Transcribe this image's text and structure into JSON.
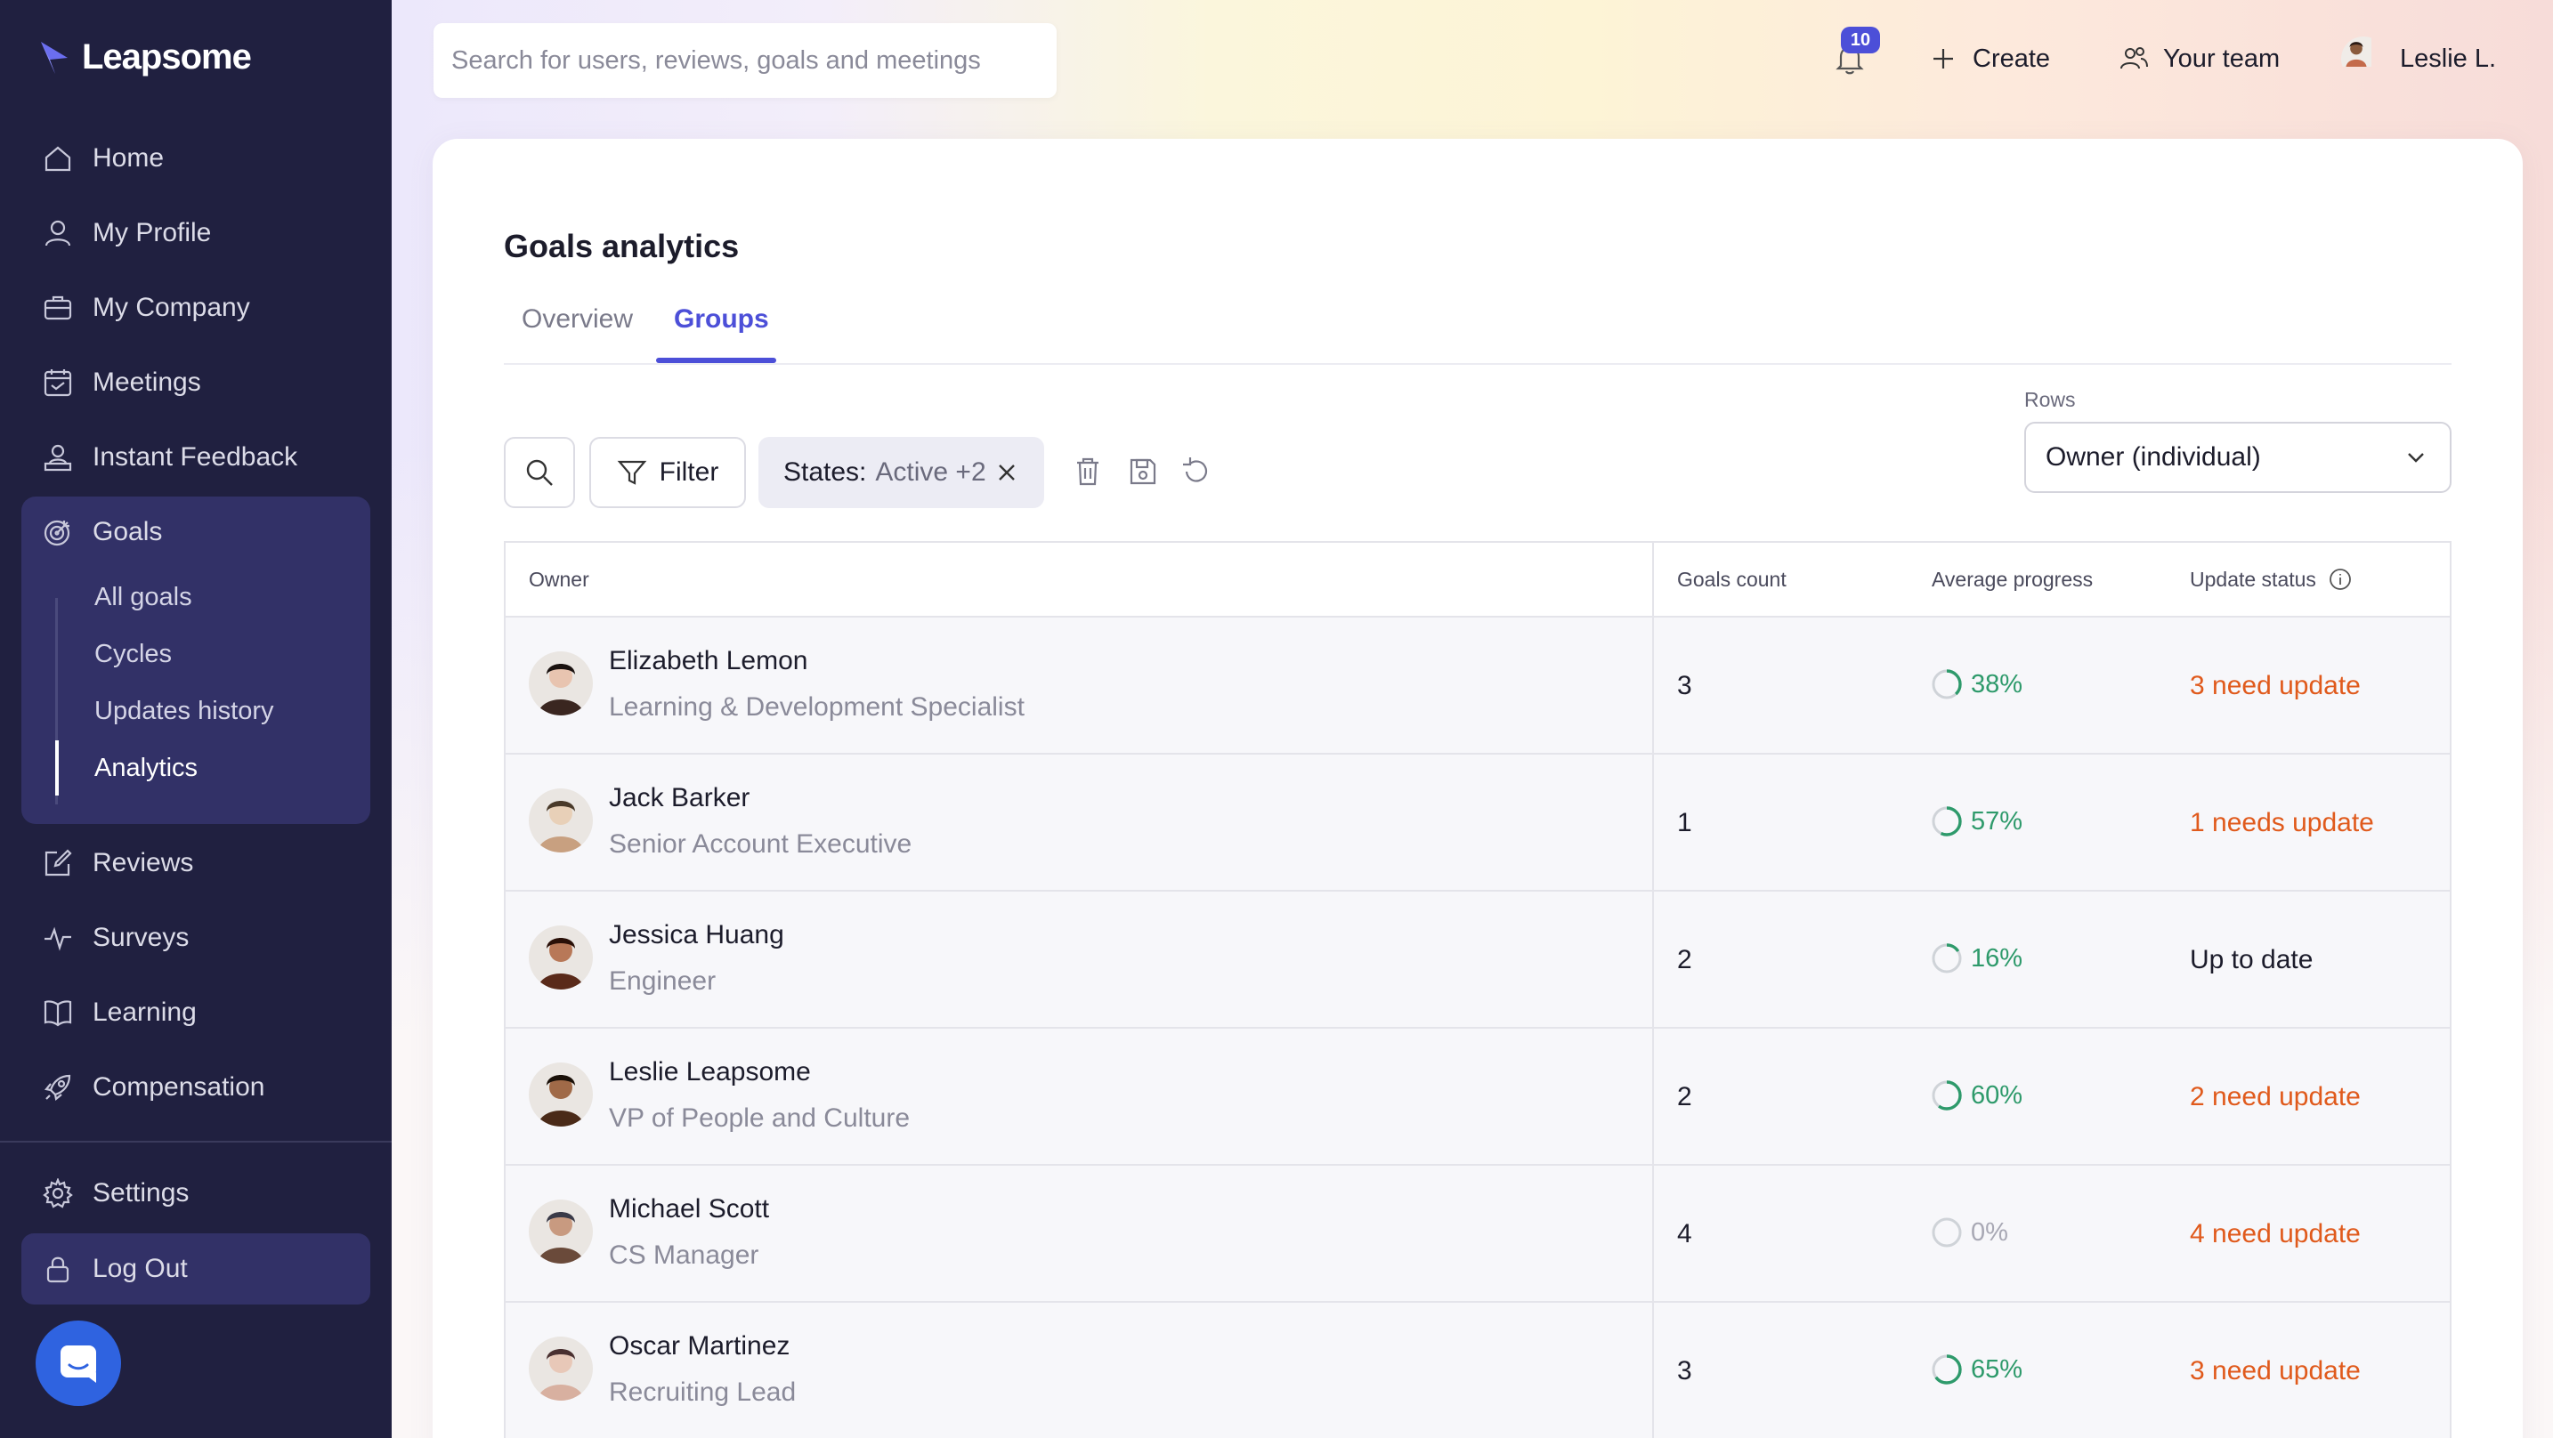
{
  "brand": {
    "name": "Leapsome"
  },
  "sidebar": {
    "items": [
      {
        "label": "Home",
        "icon": "home-icon"
      },
      {
        "label": "My Profile",
        "icon": "user-icon"
      },
      {
        "label": "My Company",
        "icon": "briefcase-icon"
      },
      {
        "label": "Meetings",
        "icon": "calendar-icon"
      },
      {
        "label": "Instant Feedback",
        "icon": "feedback-icon"
      },
      {
        "label": "Goals",
        "icon": "target-icon"
      },
      {
        "label": "Reviews",
        "icon": "edit-icon"
      },
      {
        "label": "Surveys",
        "icon": "pulse-icon"
      },
      {
        "label": "Learning",
        "icon": "book-icon"
      },
      {
        "label": "Compensation",
        "icon": "rocket-icon"
      },
      {
        "label": "Settings",
        "icon": "gear-icon"
      },
      {
        "label": "Log Out",
        "icon": "lock-icon"
      }
    ],
    "goals_sub": [
      "All goals",
      "Cycles",
      "Updates history",
      "Analytics"
    ]
  },
  "topbar": {
    "search_placeholder": "Search for users, reviews, goals and meetings",
    "notifications": "10",
    "create": "Create",
    "team": "Your team",
    "user": "Leslie L."
  },
  "page": {
    "title": "Goals analytics",
    "tabs": [
      "Overview",
      "Groups"
    ],
    "filter_label": "Filter",
    "chip_key": "States:",
    "chip_value": "Active +2",
    "rows_label": "Rows",
    "rows_value": "Owner (individual)"
  },
  "table": {
    "headers": {
      "owner": "Owner",
      "count": "Goals count",
      "progress": "Average progress",
      "status": "Update status"
    },
    "rows": [
      {
        "name": "Elizabeth Lemon",
        "role": "Learning & Development Specialist",
        "count": "3",
        "progress": "38%",
        "progress_value": 0.38,
        "status": "3 need update",
        "status_type": "warn"
      },
      {
        "name": "Jack Barker",
        "role": "Senior Account Executive",
        "count": "1",
        "progress": "57%",
        "progress_value": 0.57,
        "status": "1 needs update",
        "status_type": "warn"
      },
      {
        "name": "Jessica Huang",
        "role": "Engineer",
        "count": "2",
        "progress": "16%",
        "progress_value": 0.16,
        "status": "Up to date",
        "status_type": "ok"
      },
      {
        "name": "Leslie Leapsome",
        "role": "VP of People and Culture",
        "count": "2",
        "progress": "60%",
        "progress_value": 0.6,
        "status": "2 need update",
        "status_type": "warn"
      },
      {
        "name": "Michael Scott",
        "role": "CS Manager",
        "count": "4",
        "progress": "0%",
        "progress_value": 0,
        "status": "4 need update",
        "status_type": "warn"
      },
      {
        "name": "Oscar Martinez",
        "role": "Recruiting Lead",
        "count": "3",
        "progress": "65%",
        "progress_value": 0.65,
        "status": "3 need update",
        "status_type": "warn"
      }
    ]
  },
  "colors": {
    "accent": "#4c4fd8",
    "sidebar": "#202040",
    "progress": "#2e9a6b",
    "warn": "#e05a1c"
  }
}
